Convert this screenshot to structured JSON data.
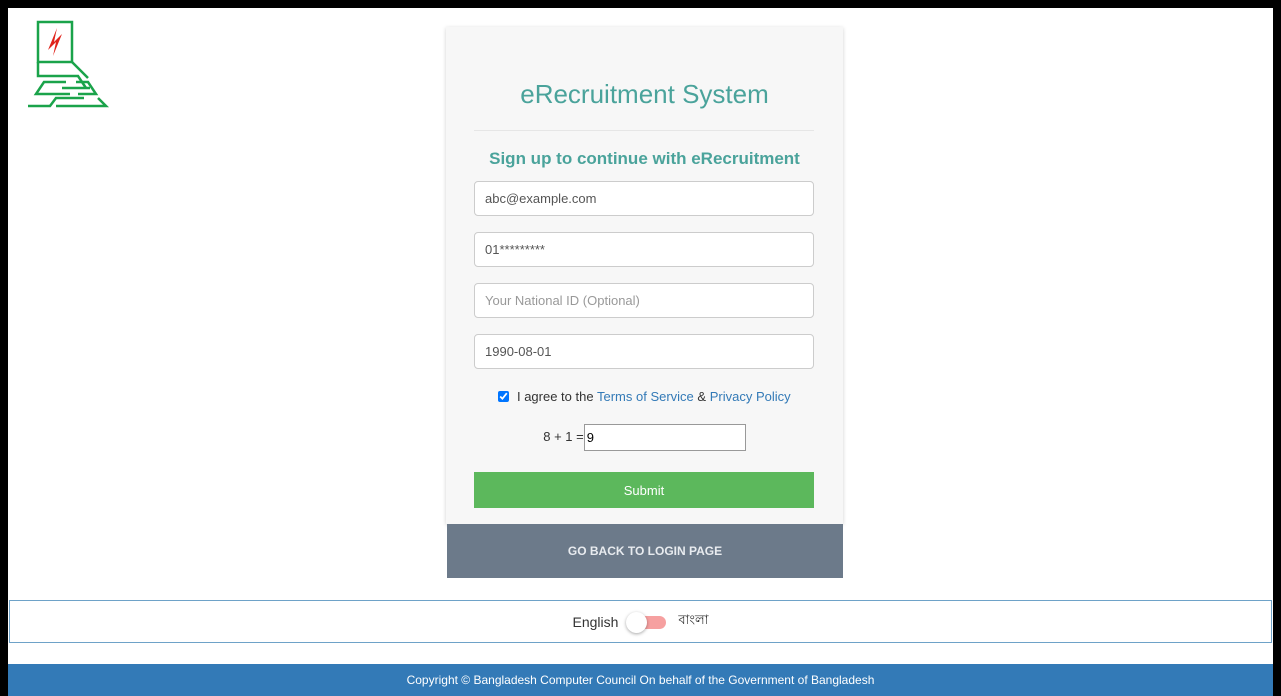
{
  "logo": {
    "icon": "bcc-logo-icon",
    "colors": {
      "green": "#1aa34a",
      "red": "#e0231b"
    }
  },
  "card": {
    "title": "eRecruitment System",
    "subtitle": "Sign up to continue with eRecruitment",
    "email": {
      "value": "abc@example.com"
    },
    "mobile": {
      "value": "01*********"
    },
    "nid": {
      "value": "",
      "placeholder": "Your National ID (Optional)"
    },
    "dob": {
      "value": "1990-08-01"
    },
    "agree": {
      "checked": true,
      "prefix": "I agree to the",
      "terms_label": "Terms of Service",
      "ampersand": "&",
      "privacy_label": "Privacy Policy"
    },
    "captcha": {
      "question": "8 + 1 =",
      "value": "9"
    },
    "submit_label": "Submit"
  },
  "back_to_login_label": "GO BACK TO LOGIN PAGE",
  "language": {
    "english_label": "English",
    "bangla_label": "বাংলা",
    "toggle_on": false
  },
  "footer": {
    "text": "Copyright © Bangladesh Computer Council On behalf of the Government of Bangladesh"
  },
  "colors": {
    "accent_teal": "#4aa39b",
    "submit_green": "#5cb85c",
    "back_button": "#6c7a8a",
    "footer_blue": "#337ab7",
    "link_blue": "#337ab7"
  }
}
